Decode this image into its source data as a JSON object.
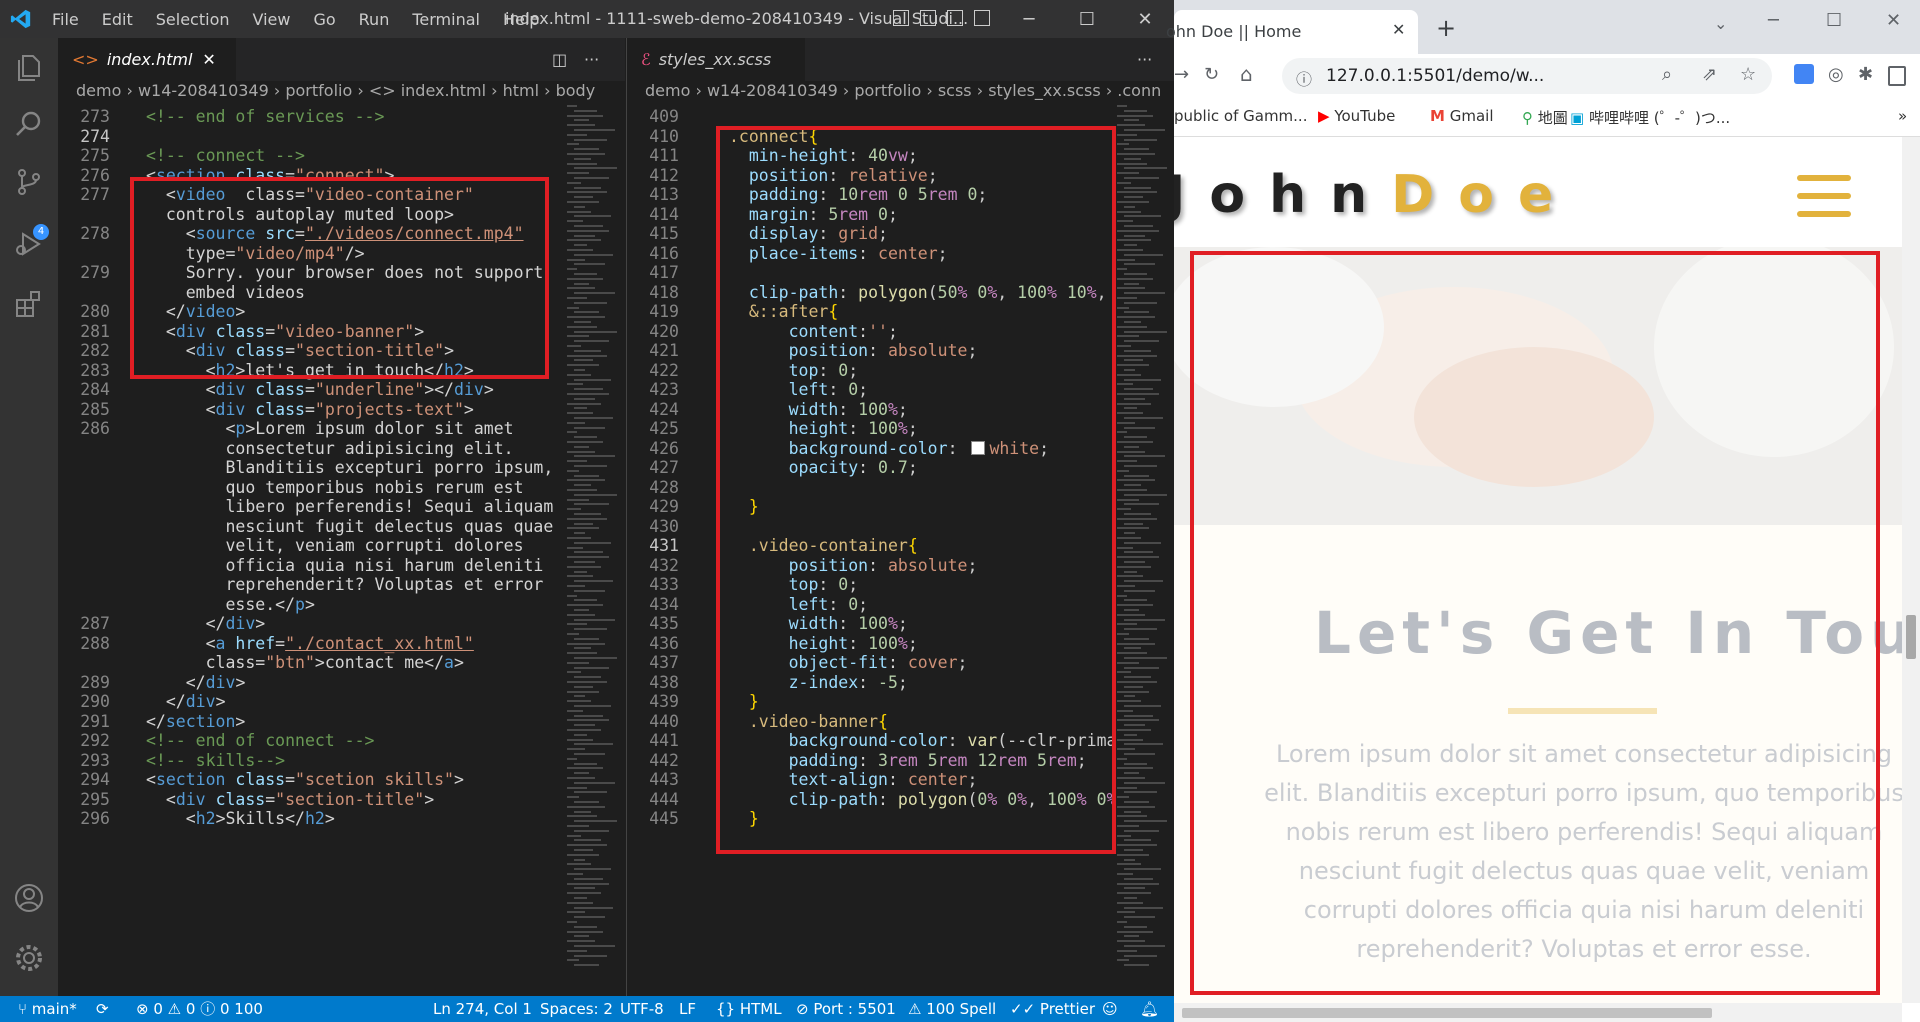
{
  "vscode": {
    "menu": [
      "File",
      "Edit",
      "Selection",
      "View",
      "Go",
      "Run",
      "Terminal",
      "Help"
    ],
    "window_title": "index.html - 1111-sweb-demo-208410349 - Visual Studi...",
    "scm_badge": "4",
    "left_tab": "index.html",
    "right_tab": "styles_xx.scss",
    "left_breadcrumb": "demo  ›  w14-208410349  ›  portfolio  ›  <>  index.html  ›  html  ›  body",
    "right_breadcrumb": "demo  ›  w14-208410349  ›  portfolio  ›  scss  ›  styles_xx.scss  ›  .conn",
    "html_lines": [
      {
        "n": "273",
        "t": "<!-- end of services -->"
      },
      {
        "n": "274",
        "t": ""
      },
      {
        "n": "275",
        "t": "<!-- connect -->"
      },
      {
        "n": "276",
        "t": "<section class=\"connect\">"
      },
      {
        "n": "277",
        "t": "  <video  class=\"video-container\""
      },
      {
        "n": "",
        "t": "  controls autoplay muted loop>"
      },
      {
        "n": "278",
        "t": "    <source src=\"./videos/connect.mp4\""
      },
      {
        "n": "",
        "t": "    type=\"video/mp4\"/>"
      },
      {
        "n": "279",
        "t": "    Sorry. your browser does not support"
      },
      {
        "n": "",
        "t": "    embed videos"
      },
      {
        "n": "280",
        "t": "  </video>"
      },
      {
        "n": "281",
        "t": "  <div class=\"video-banner\">"
      },
      {
        "n": "282",
        "t": "    <div class=\"section-title\">"
      },
      {
        "n": "283",
        "t": "      <h2>let's get in touch</h2>"
      },
      {
        "n": "284",
        "t": "      <div class=\"underline\"></div>"
      },
      {
        "n": "285",
        "t": "      <div class=\"projects-text\">"
      },
      {
        "n": "286",
        "t": "        <p>Lorem ipsum dolor sit amet"
      },
      {
        "n": "",
        "t": "        consectetur adipisicing elit."
      },
      {
        "n": "",
        "t": "        Blanditiis excepturi porro ipsum,"
      },
      {
        "n": "",
        "t": "        quo temporibus nobis rerum est"
      },
      {
        "n": "",
        "t": "        libero perferendis! Sequi aliquam"
      },
      {
        "n": "",
        "t": "        nesciunt fugit delectus quas quae"
      },
      {
        "n": "",
        "t": "        velit, veniam corrupti dolores"
      },
      {
        "n": "",
        "t": "        officia quia nisi harum deleniti"
      },
      {
        "n": "",
        "t": "        reprehenderit? Voluptas et error"
      },
      {
        "n": "",
        "t": "        esse.</p>"
      },
      {
        "n": "287",
        "t": "      </div>"
      },
      {
        "n": "288",
        "t": "      <a href=\"./contact_xx.html\""
      },
      {
        "n": "",
        "t": "      class=\"btn\">contact me</a>"
      },
      {
        "n": "289",
        "t": "    </div>"
      },
      {
        "n": "290",
        "t": "  </div>"
      },
      {
        "n": "291",
        "t": "</section>"
      },
      {
        "n": "292",
        "t": "<!-- end of connect -->"
      },
      {
        "n": "293",
        "t": "<!-- skills-->"
      },
      {
        "n": "294",
        "t": "<section class=\"scetion skills\">"
      },
      {
        "n": "295",
        "t": "  <div class=\"section-title\">"
      },
      {
        "n": "296",
        "t": "    <h2>Skills</h2>"
      }
    ],
    "scss_lines": [
      {
        "n": "409",
        "t": ""
      },
      {
        "n": "410",
        "t": ".connect{"
      },
      {
        "n": "411",
        "t": "  min-height: 40vw;"
      },
      {
        "n": "412",
        "t": "  position: relative;"
      },
      {
        "n": "413",
        "t": "  padding: 10rem 0 5rem 0;"
      },
      {
        "n": "414",
        "t": "  margin: 5rem 0;"
      },
      {
        "n": "415",
        "t": "  display: grid;"
      },
      {
        "n": "416",
        "t": "  place-items: center;"
      },
      {
        "n": "417",
        "t": ""
      },
      {
        "n": "418",
        "t": "  clip-path: polygon(50% 0%, 100% 10%, 1"
      },
      {
        "n": "419",
        "t": "  &::after{"
      },
      {
        "n": "420",
        "t": "      content:'';"
      },
      {
        "n": "421",
        "t": "      position: absolute;"
      },
      {
        "n": "422",
        "t": "      top: 0;"
      },
      {
        "n": "423",
        "t": "      left: 0;"
      },
      {
        "n": "424",
        "t": "      width: 100%;"
      },
      {
        "n": "425",
        "t": "      height: 100%;"
      },
      {
        "n": "426",
        "t": "      background-color:   white;"
      },
      {
        "n": "427",
        "t": "      opacity: 0.7;"
      },
      {
        "n": "428",
        "t": ""
      },
      {
        "n": "429",
        "t": "  }"
      },
      {
        "n": "430",
        "t": ""
      },
      {
        "n": "431",
        "t": "  .video-container{"
      },
      {
        "n": "432",
        "t": "      position: absolute;"
      },
      {
        "n": "433",
        "t": "      top: 0;"
      },
      {
        "n": "434",
        "t": "      left: 0;"
      },
      {
        "n": "435",
        "t": "      width: 100%;"
      },
      {
        "n": "436",
        "t": "      height: 100%;"
      },
      {
        "n": "437",
        "t": "      object-fit: cover;"
      },
      {
        "n": "438",
        "t": "      z-index: -5;"
      },
      {
        "n": "439",
        "t": "  }"
      },
      {
        "n": "440",
        "t": "  .video-banner{"
      },
      {
        "n": "441",
        "t": "      background-color: var(--clr-primar"
      },
      {
        "n": "442",
        "t": "      padding: 3rem 5rem 12rem 5rem;"
      },
      {
        "n": "443",
        "t": "      text-align: center;"
      },
      {
        "n": "444",
        "t": "      clip-path: polygon(0% 0%, 100% 0%"
      },
      {
        "n": "445",
        "t": "  }"
      }
    ],
    "status": {
      "branch": "main*",
      "errors": "0",
      "warnings": "0",
      "info": "0",
      "count": "100",
      "position": "Ln 274, Col 1",
      "spaces": "Spaces: 2",
      "encoding": "UTF-8",
      "eol": "LF",
      "language": "HTML",
      "port": "Port : 5501",
      "spell": "100 Spell",
      "prettier": "Prettier"
    }
  },
  "browser": {
    "tab_title": "ohn Doe || Home",
    "url": "127.0.0.1:5501/demo/w...",
    "bookmarks": [
      "public of Gamm...",
      "YouTube",
      "Gmail",
      "地圖",
      "哔哩哔哩 (゜-゜)つ..."
    ],
    "logo_first": "John",
    "logo_last": "Doe",
    "heading": "Let's Get In Touch",
    "paragraph": "Lorem ipsum dolor sit amet consectetur adipisicing elit. Blanditiis excepturi porro ipsum, quo temporibus nobis rerum est libero perferendis! Sequi aliquam nesciunt fugit delectus quas quae velit, veniam corrupti dolores officia quia nisi harum deleniti reprehenderit? Voluptas et error esse.",
    "colors": {
      "accent": "#e2b23c",
      "heading": "#b9bdc4",
      "highlight_box": "#e01e24"
    }
  }
}
